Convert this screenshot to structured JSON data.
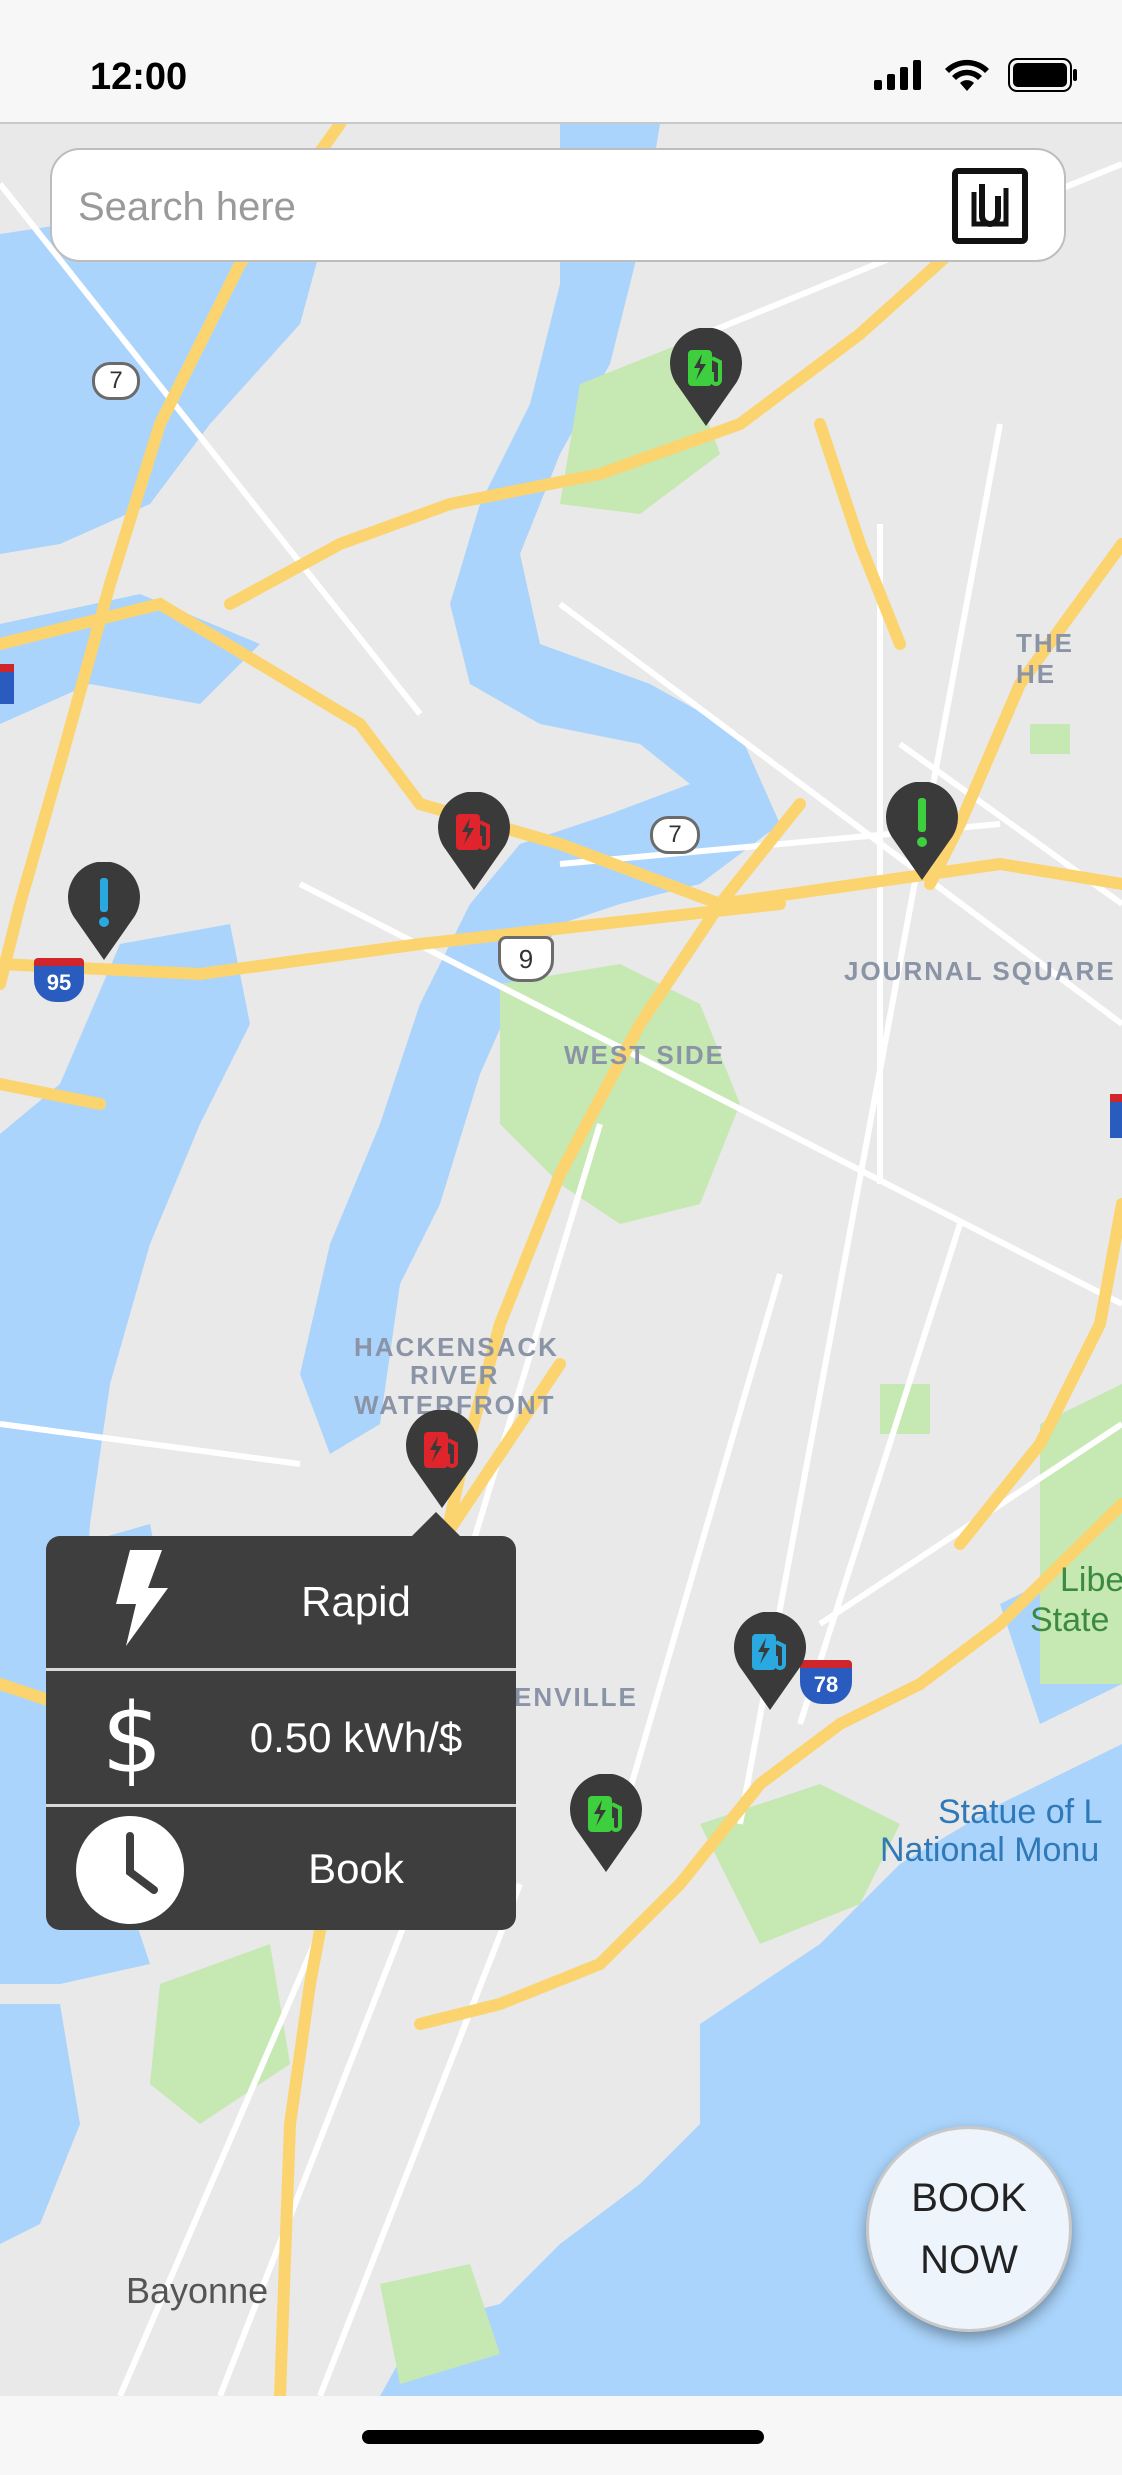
{
  "status_bar": {
    "time": "12:00",
    "icons": [
      "cellular-signal-icon",
      "wifi-icon",
      "battery-icon"
    ]
  },
  "search": {
    "placeholder": "Search here",
    "value": "",
    "scan_icon": "nfc-scan-icon"
  },
  "map": {
    "labels": {
      "the_heights": "THE HE",
      "journal_square": "JOURNAL SQUARE",
      "west_side": "WEST SIDE",
      "hackensack_1": "HACKENSACK",
      "hackensack_2": "RIVER",
      "hackensack_3": "WATERFRONT",
      "greenville": "ENVILLE",
      "liberty_1": "Libe",
      "liberty_2": "State",
      "statue_1": "Statue of L",
      "statue_2": "National Monu",
      "bayonne": "Bayonne"
    },
    "route_shields": {
      "r7_a": "7",
      "r7_b": "7",
      "r9": "9",
      "i95": "95",
      "i78": "78"
    },
    "pins": [
      {
        "name": "charger-pin-green-1",
        "status": "available",
        "color": "#3ecf3e",
        "icon": "ev-charger-icon"
      },
      {
        "name": "charger-pin-red-1",
        "status": "occupied",
        "color": "#e0242c",
        "icon": "ev-charger-icon"
      },
      {
        "name": "alert-pin-green",
        "status": "alert",
        "color": "#3ecf3e",
        "icon": "exclamation-icon"
      },
      {
        "name": "alert-pin-blue",
        "status": "alert",
        "color": "#29a9e0",
        "icon": "exclamation-icon"
      },
      {
        "name": "charger-pin-red-2",
        "status": "selected",
        "color": "#e0242c",
        "icon": "ev-charger-icon"
      },
      {
        "name": "charger-pin-blue",
        "status": "available",
        "color": "#29a9e0",
        "icon": "ev-charger-icon"
      },
      {
        "name": "charger-pin-green-2",
        "status": "available",
        "color": "#3ecf3e",
        "icon": "ev-charger-icon"
      }
    ]
  },
  "popup": {
    "speed_label": "Rapid",
    "price_label": "0.50 kWh/$",
    "book_label": "Book",
    "icons": [
      "lightning-icon",
      "dollar-icon",
      "clock-icon"
    ]
  },
  "book_now": {
    "line1": "BOOK",
    "line2": "NOW"
  },
  "colors": {
    "land": "#e9e9e9",
    "water": "#aad4fb",
    "park": "#c6e8b2",
    "highway": "#fbd46f",
    "pin_body": "#3a3a3a",
    "popup_bg": "#3e3e3e"
  }
}
